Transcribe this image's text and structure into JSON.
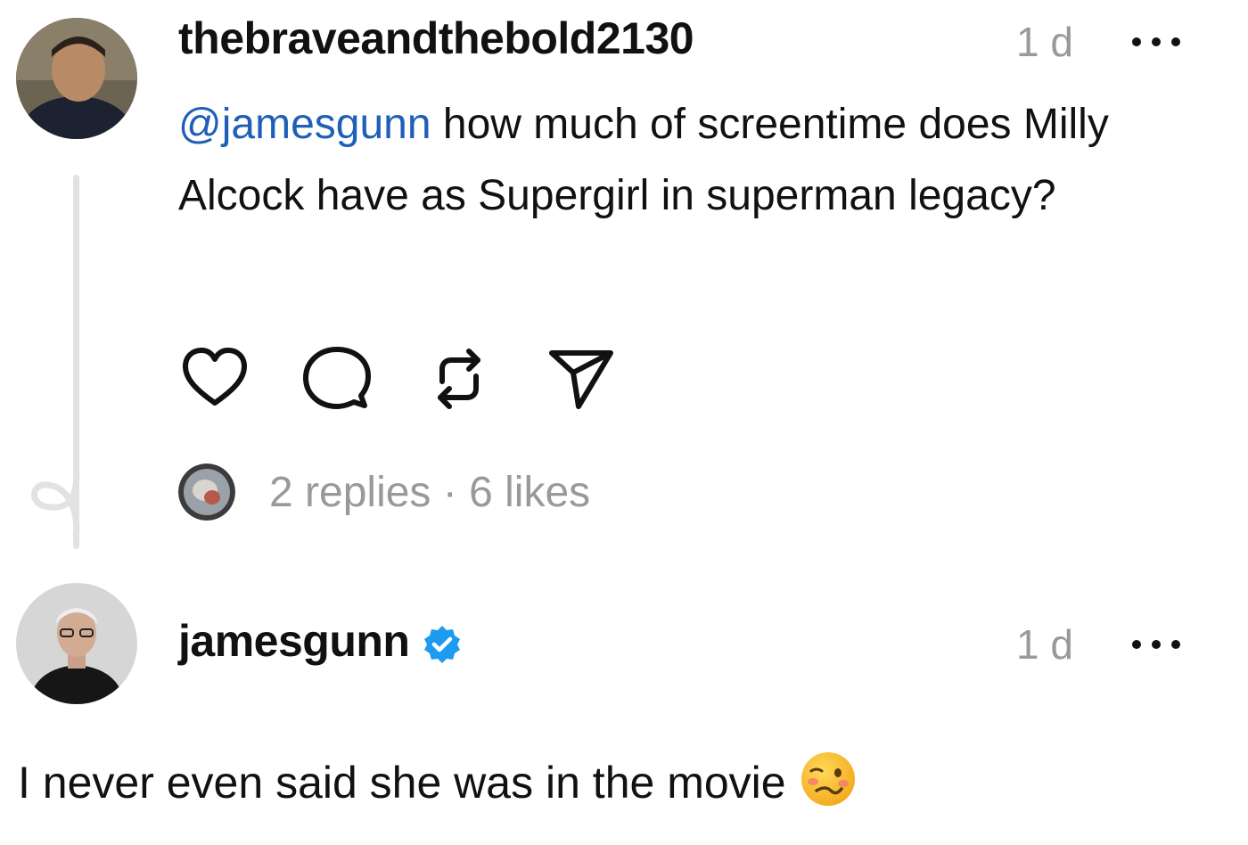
{
  "post": {
    "username": "thebraveandthebold2130",
    "time": "1 d",
    "mention": "@jamesgunn",
    "text": " how much of screentime does Milly Alcock have as Supergirl in superman legacy?",
    "actions": [
      "heart-icon",
      "comment-icon",
      "repost-icon",
      "share-icon"
    ],
    "replies": "2 replies",
    "separator": " · ",
    "likes": "6 likes"
  },
  "reply": {
    "username": "jamesgunn",
    "verified": true,
    "time": "1 d",
    "text": "I never even said she was in the movie",
    "emoji": "woozy-face-emoji"
  },
  "colors": {
    "mention": "#1f5fb8",
    "secondary_text": "#999999",
    "verified": "#1d9bf0",
    "thread_line": "#e2e2e2"
  }
}
